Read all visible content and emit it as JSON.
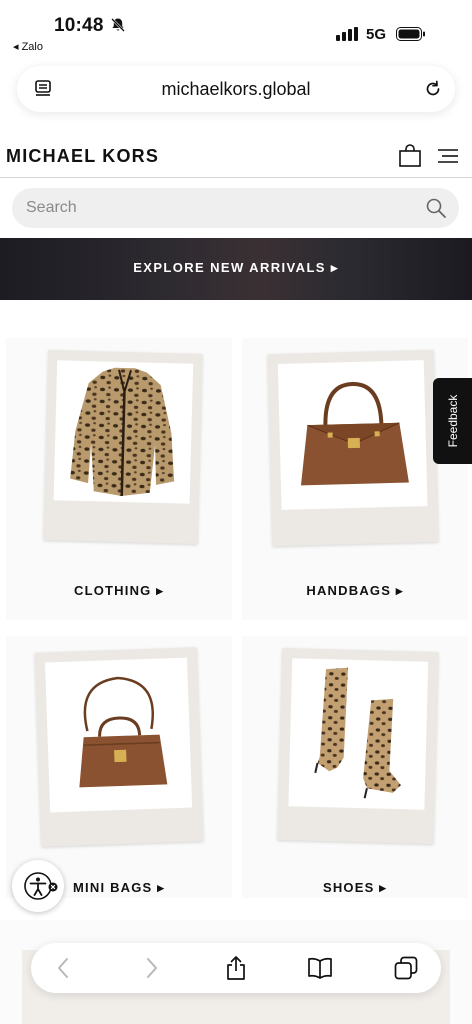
{
  "status_bar": {
    "time": "10:48",
    "back_app": "◂ Zalo",
    "network": "5G"
  },
  "browser": {
    "url": "michaelkors.global"
  },
  "site": {
    "logo": "MICHAEL KORS"
  },
  "search": {
    "placeholder": "Search"
  },
  "banner": {
    "label": "EXPLORE NEW ARRIVALS ▸"
  },
  "categories": [
    {
      "label": "CLOTHING ▸"
    },
    {
      "label": "HANDBAGS ▸"
    },
    {
      "label": "MINI BAGS ▸"
    },
    {
      "label": "SHOES ▸"
    }
  ],
  "feedback": {
    "label": "Feedback"
  },
  "icons": {
    "bell": "bell-slash-icon",
    "signal": "signal-icon",
    "battery": "battery-icon",
    "reader": "reader-mode-icon",
    "reload": "reload-icon",
    "bag": "shopping-bag-icon",
    "menu": "hamburger-menu-icon",
    "search": "search-icon",
    "a11y": "accessibility-icon",
    "back": "chevron-left-icon",
    "forward": "chevron-right-icon",
    "share": "share-icon",
    "bookmarks": "book-icon",
    "tabs": "tabs-icon"
  },
  "colors": {
    "banner": "#2d2a30",
    "text": "#111111",
    "polaroid": "#ece9e4",
    "leather": "#8a5230"
  }
}
